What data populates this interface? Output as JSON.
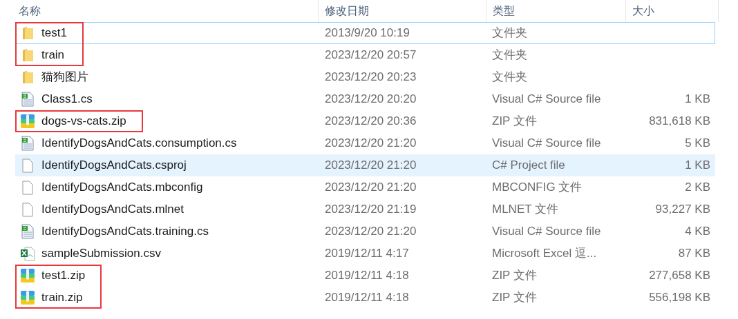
{
  "columns": [
    "名称",
    "修改日期",
    "类型",
    "大小"
  ],
  "rows": [
    {
      "kind": "folder",
      "name": "test1",
      "date": "2013/9/20 10:19",
      "type": "文件夹",
      "focused": true,
      "hovered": false,
      "outlined": true
    },
    {
      "kind": "folder",
      "name": "train",
      "date": "2023/12/20 20:57",
      "type": "文件夹",
      "focused": false,
      "hovered": false,
      "outlined": true
    },
    {
      "kind": "folder",
      "name": "猫狗图片",
      "date": "2023/12/20 20:23",
      "type": "文件夹",
      "focused": false,
      "hovered": false,
      "outlined": false
    },
    {
      "kind": "csharp",
      "name": "Class1.cs",
      "date": "2023/12/20 20:20",
      "type": "Visual C# Source file",
      "size": "1 KB",
      "focused": false,
      "hovered": false,
      "outlined": false
    },
    {
      "kind": "zip",
      "name": "dogs-vs-cats.zip",
      "date": "2023/12/20 20:36",
      "type": "ZIP 文件",
      "size": "831,618 KB",
      "focused": false,
      "hovered": false,
      "outlined": true
    },
    {
      "kind": "csharp",
      "name": "IdentifyDogsAndCats.consumption.cs",
      "date": "2023/12/20 21:20",
      "type": "Visual C# Source file",
      "size": "5 KB",
      "focused": false,
      "hovered": false,
      "outlined": false
    },
    {
      "kind": "plain",
      "name": "IdentifyDogsAndCats.csproj",
      "date": "2023/12/20 21:20",
      "type": "C# Project file",
      "size": "1 KB",
      "focused": false,
      "hovered": true,
      "outlined": false
    },
    {
      "kind": "plain",
      "name": "IdentifyDogsAndCats.mbconfig",
      "date": "2023/12/20 21:20",
      "type": "MBCONFIG 文件",
      "size": "2 KB",
      "focused": false,
      "hovered": false,
      "outlined": false
    },
    {
      "kind": "plain",
      "name": "IdentifyDogsAndCats.mlnet",
      "date": "2023/12/20 21:19",
      "type": "MLNET 文件",
      "size": "93,227 KB",
      "focused": false,
      "hovered": false,
      "outlined": false
    },
    {
      "kind": "csharp",
      "name": "IdentifyDogsAndCats.training.cs",
      "date": "2023/12/20 21:20",
      "type": "Visual C# Source file",
      "size": "4 KB",
      "focused": false,
      "hovered": false,
      "outlined": false
    },
    {
      "kind": "excel",
      "name": "sampleSubmission.csv",
      "date": "2019/12/11 4:17",
      "type": "Microsoft Excel 逗...",
      "size": "87 KB",
      "focused": false,
      "hovered": false,
      "outlined": false
    },
    {
      "kind": "zip",
      "name": "test1.zip",
      "date": "2019/12/11 4:18",
      "type": "ZIP 文件",
      "size": "277,658 KB",
      "focused": false,
      "hovered": false,
      "outlined": true
    },
    {
      "kind": "zip",
      "name": "train.zip",
      "date": "2019/12/11 4:18",
      "type": "ZIP 文件",
      "size": "556,198 KB",
      "focused": false,
      "hovered": false,
      "outlined": true
    }
  ]
}
